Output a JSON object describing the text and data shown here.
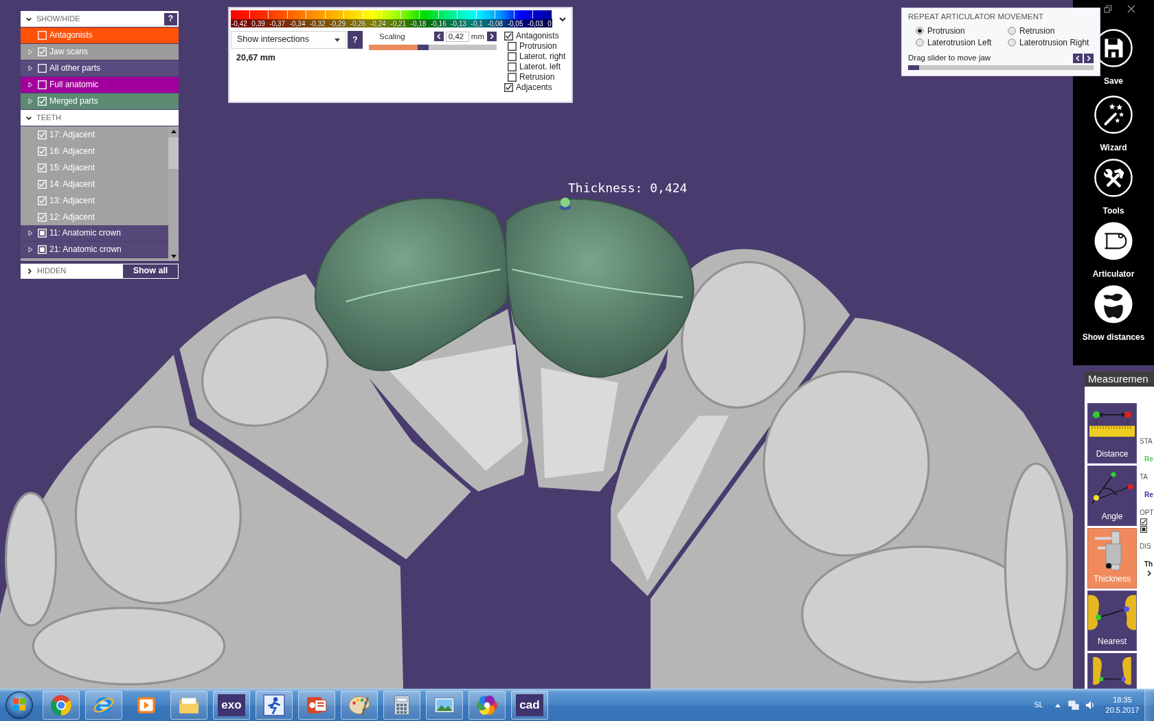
{
  "show_hide": {
    "title": "SHOW/HIDE",
    "expanded": true,
    "help": "?",
    "groups": [
      {
        "label": "Antagonists",
        "checked": false,
        "expandable": false,
        "color": "#ff5207"
      },
      {
        "label": "Jaw scans",
        "checked": true,
        "expandable": true,
        "color": "#9c9c9c"
      },
      {
        "label": "All other parts",
        "checked": false,
        "expandable": true,
        "color": "#584b7f"
      },
      {
        "label": "Full anatomic",
        "checked": false,
        "expandable": true,
        "color": "#a2009c"
      },
      {
        "label": "Merged parts",
        "checked": true,
        "expandable": true,
        "color": "#5c8a72"
      }
    ]
  },
  "teeth": {
    "title": "TEETH",
    "expanded": true,
    "items": [
      {
        "label": "17: Adjacent",
        "kind": "adjacent",
        "checked": true,
        "indeterminate": false,
        "expandable": false
      },
      {
        "label": "16: Adjacent",
        "kind": "adjacent",
        "checked": true,
        "indeterminate": false,
        "expandable": false
      },
      {
        "label": "15: Adjacent",
        "kind": "adjacent",
        "checked": true,
        "indeterminate": false,
        "expandable": false
      },
      {
        "label": "14: Adjacent",
        "kind": "adjacent",
        "checked": true,
        "indeterminate": false,
        "expandable": false
      },
      {
        "label": "13: Adjacent",
        "kind": "adjacent",
        "checked": true,
        "indeterminate": false,
        "expandable": false
      },
      {
        "label": "12: Adjacent",
        "kind": "adjacent",
        "checked": true,
        "indeterminate": false,
        "expandable": false
      },
      {
        "label": "11: Anatomic crown",
        "kind": "crown",
        "checked": false,
        "indeterminate": true,
        "expandable": true
      },
      {
        "label": "21: Anatomic crown",
        "kind": "crown",
        "checked": false,
        "indeterminate": true,
        "expandable": true
      }
    ]
  },
  "hidden": {
    "title": "HIDDEN",
    "expanded": false,
    "button": "Show all"
  },
  "color_scale": {
    "labels": [
      "-0,42",
      "0,39",
      "-0,37",
      "-0,34",
      "-0,32",
      "-0,29",
      "-0,26",
      "-0,24",
      "-0,21",
      "-0,18",
      "-0,16",
      "-0,13",
      "-0,1",
      "-0,08",
      "-0,05",
      "-0,03",
      "0"
    ]
  },
  "intersections": {
    "mode": "Show intersections",
    "help": "?",
    "result": "20,67 mm"
  },
  "scaling": {
    "label": "Scaling",
    "value": "0,42",
    "unit": "mm",
    "level": 0.38
  },
  "display_options": [
    {
      "label": "Antagonists",
      "checked": true,
      "children": [
        {
          "label": "Protrusion",
          "checked": false
        },
        {
          "label": "Laterot. right",
          "checked": false
        },
        {
          "label": "Laterot. left",
          "checked": false
        },
        {
          "label": "Retrusion",
          "checked": false
        }
      ]
    },
    {
      "label": "Adjacents",
      "checked": true
    }
  ],
  "articulator_movement": {
    "title": "REPEAT ARTICULATOR MOVEMENT",
    "movements": [
      {
        "label": "Protrusion",
        "selected": true
      },
      {
        "label": "Retrusion",
        "selected": false
      },
      {
        "label": "Laterotrusion Left",
        "selected": false
      },
      {
        "label": "Laterotrusion Right",
        "selected": false
      }
    ],
    "hint": "Drag slider to move jaw",
    "level": 0.06
  },
  "viewport": {
    "annotation": "Thickness: 0,424"
  },
  "toolbar": [
    {
      "label": "Save",
      "kind": "save"
    },
    {
      "label": "Wizard",
      "kind": "wizard"
    },
    {
      "label": "Tools",
      "kind": "tools"
    },
    {
      "label": "Articulator",
      "kind": "articulator"
    },
    {
      "label": "Show distances",
      "kind": "distances"
    }
  ],
  "measurement": {
    "title": "Measuremen",
    "tools": [
      {
        "label": "Distance",
        "kind": "distance",
        "selected": false
      },
      {
        "label": "Angle",
        "kind": "angle",
        "selected": false
      },
      {
        "label": "Thickness",
        "kind": "thickness",
        "selected": true
      },
      {
        "label": "Nearest",
        "kind": "nearest",
        "selected": false
      },
      {
        "kind": "teeth_line",
        "selected": false
      }
    ],
    "details": [
      {
        "kind": "heading",
        "text": "STA"
      },
      {
        "kind": "value",
        "text": "Re",
        "color": "#5cc45c"
      },
      {
        "kind": "heading",
        "text": "TA"
      },
      {
        "kind": "value",
        "text": "Re",
        "color": "#3a2d9a"
      },
      {
        "kind": "heading",
        "text": "OPT"
      },
      {
        "kind": "checkbox",
        "checked": true,
        "indeterminate": false
      },
      {
        "kind": "checkbox",
        "checked": false,
        "indeterminate": true
      },
      {
        "kind": "heading",
        "text": "DIS"
      },
      {
        "kind": "value",
        "text": "Th",
        "color": "#222222"
      },
      {
        "kind": "expander",
        "expanded": false
      }
    ]
  },
  "taskbar": {
    "apps": [
      {
        "kind": "chrome",
        "running": true
      },
      {
        "kind": "ie",
        "running": true
      },
      {
        "kind": "media",
        "running": false
      },
      {
        "kind": "explorer",
        "running": true
      },
      {
        "kind": "text",
        "text": "exo",
        "running": true
      },
      {
        "kind": "figure",
        "running": true
      },
      {
        "kind": "powerpoint",
        "running": true
      },
      {
        "kind": "paint",
        "running": true
      },
      {
        "kind": "calculator",
        "running": true
      },
      {
        "kind": "photos",
        "running": true
      },
      {
        "kind": "picasa",
        "running": true
      },
      {
        "kind": "text",
        "text": "cad",
        "running": true
      }
    ],
    "language": "SL",
    "time": "18:35",
    "date": "20.5.2017"
  }
}
